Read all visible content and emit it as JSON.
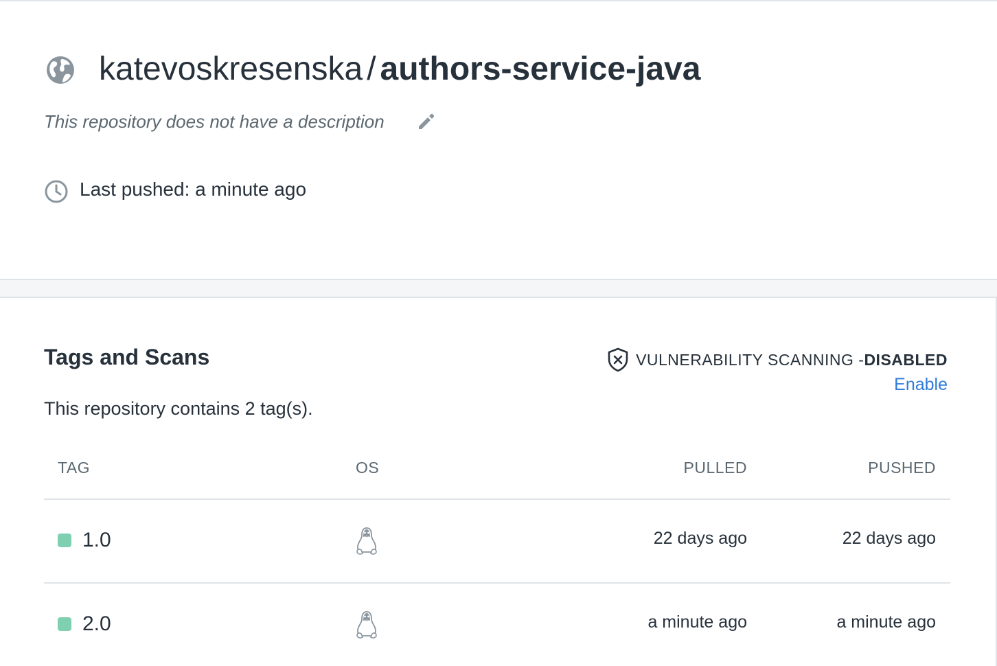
{
  "repo": {
    "owner": "katevoskresenska",
    "separator": "/",
    "name": "authors-service-java",
    "description": "This repository does not have a description",
    "last_pushed": "Last pushed: a minute ago"
  },
  "tags_section": {
    "title": "Tags and Scans",
    "count_text": "This repository contains 2 tag(s).",
    "vulnerability": {
      "label": "VULNERABILITY SCANNING - ",
      "status": "DISABLED",
      "enable_label": "Enable"
    },
    "columns": {
      "tag": "TAG",
      "os": "OS",
      "pulled": "PULLED",
      "pushed": "PUSHED"
    },
    "rows": [
      {
        "tag": "1.0",
        "os_icon": "linux-icon",
        "pulled": "22 days ago",
        "pushed": "22 days ago"
      },
      {
        "tag": "2.0",
        "os_icon": "linux-icon",
        "pulled": "a minute ago",
        "pushed": "a minute ago"
      }
    ]
  },
  "colors": {
    "accent_link": "#2f7bd9",
    "tag_status": "#7fd0b0",
    "text_primary": "#27313b",
    "text_muted": "#5b6770",
    "icon_gray": "#8a959e"
  },
  "icons": [
    "globe-icon",
    "pencil-icon",
    "clock-icon",
    "shield-x-icon",
    "linux-icon"
  ]
}
